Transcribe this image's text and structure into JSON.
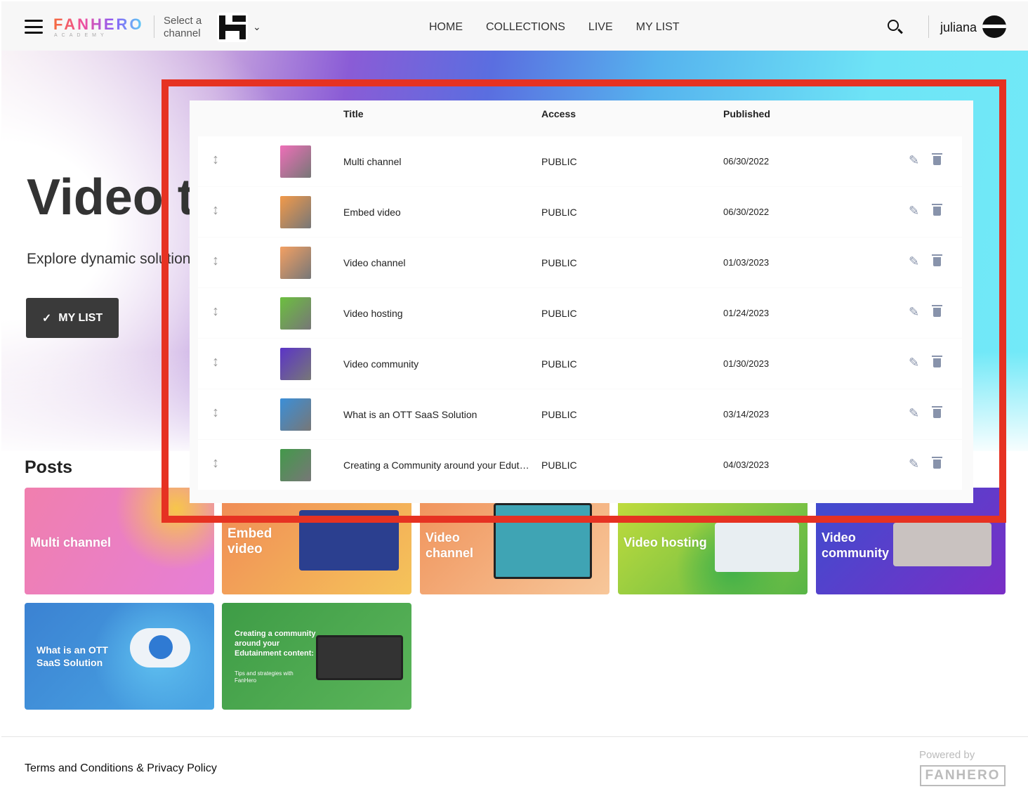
{
  "header": {
    "logo": "FANHERO",
    "logo_sub": "ACADEMY",
    "channel_label": "Select a channel",
    "nav": [
      "HOME",
      "COLLECTIONS",
      "LIVE",
      "MY LIST"
    ],
    "user": "juliana"
  },
  "hero": {
    "title": "Video t",
    "subtitle": "Explore dynamic solution",
    "my_list_label": "MY LIST"
  },
  "posts": {
    "heading": "Posts",
    "cards": [
      {
        "title": "Multi channel",
        "color": "#ee7fb0"
      },
      {
        "title": "Embed video",
        "color": "#f2a35a"
      },
      {
        "title": "Video channel",
        "color": "#f3a468"
      },
      {
        "title": "Video hosting",
        "color": "#8cc63f"
      },
      {
        "title": "Video community",
        "color": "#6a3fd0"
      },
      {
        "title": "What is an OTT SaaS Solution",
        "color": "#3f8fd6"
      },
      {
        "title": "Creating a community around your Edutainment content:",
        "subtitle": "Tips and strategies with FanHero",
        "color": "#4a9e48"
      }
    ]
  },
  "table": {
    "columns": [
      "Title",
      "Access",
      "Published"
    ],
    "rows": [
      {
        "title": "Multi channel",
        "access": "PUBLIC",
        "published": "06/30/2022",
        "thumb": "#ee6fb8"
      },
      {
        "title": "Embed video",
        "access": "PUBLIC",
        "published": "06/30/2022",
        "thumb": "#f29a4a"
      },
      {
        "title": "Video channel",
        "access": "PUBLIC",
        "published": "01/03/2023",
        "thumb": "#f3a063"
      },
      {
        "title": "Video hosting",
        "access": "PUBLIC",
        "published": "01/24/2023",
        "thumb": "#6cbf3f"
      },
      {
        "title": "Video community",
        "access": "PUBLIC",
        "published": "01/30/2023",
        "thumb": "#5b34c7"
      },
      {
        "title": "What is an OTT SaaS Solution",
        "access": "PUBLIC",
        "published": "03/14/2023",
        "thumb": "#3b8fd8"
      },
      {
        "title": "Creating a Community around your Edutainment content",
        "access": "PUBLIC",
        "published": "04/03/2023",
        "thumb": "#43994a"
      }
    ]
  },
  "footer": {
    "terms": "Terms and Conditions & Privacy Policy",
    "powered": "Powered by",
    "powered_logo": "FANHERO"
  },
  "colors": {
    "annotation": "#e63222",
    "icon": "#8893ab"
  }
}
